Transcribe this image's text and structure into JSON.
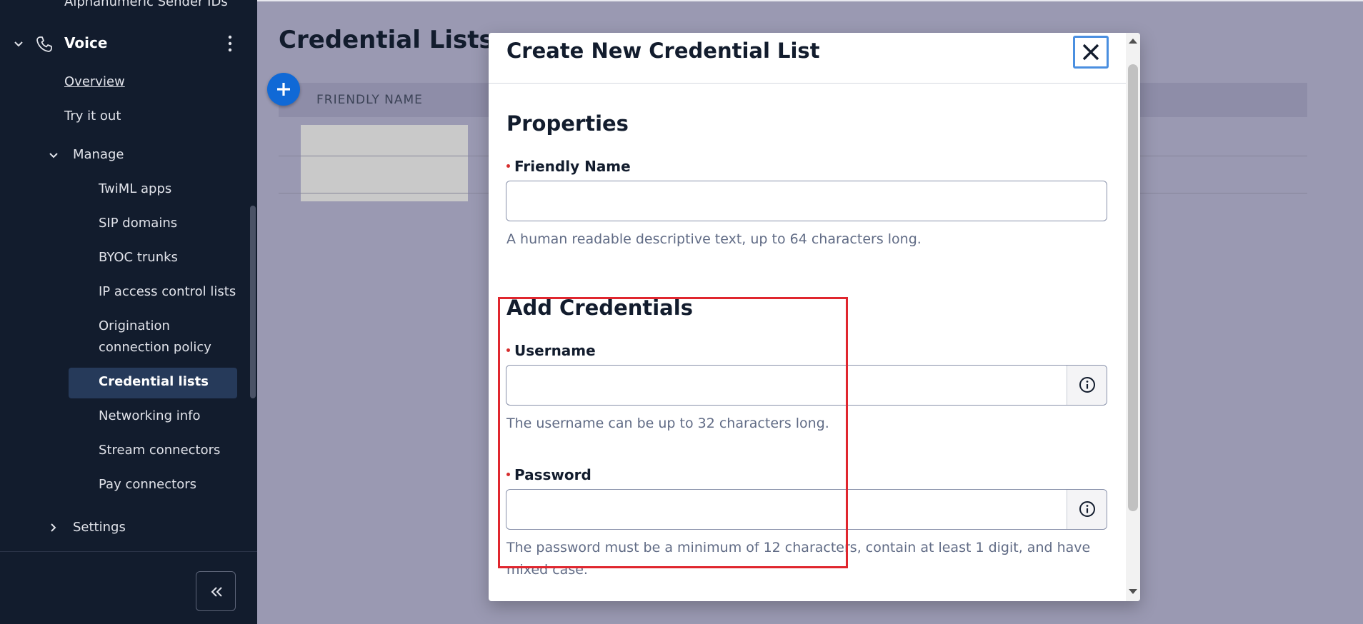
{
  "sidebar": {
    "clipped_item": "Alphanumeric Sender IDs",
    "voice_label": "Voice",
    "overview": "Overview",
    "try_it_out": "Try it out",
    "manage": "Manage",
    "manage_items": [
      "TwiML apps",
      "SIP domains",
      "BYOC trunks",
      "IP access control lists",
      "Origination",
      "connection policy",
      "Credential lists",
      "Networking info",
      "Stream connectors",
      "Pay connectors"
    ],
    "settings": "Settings"
  },
  "main": {
    "page_title": "Credential Lists",
    "table_header_friendly_name": "FRIENDLY NAME"
  },
  "modal": {
    "title": "Create New Credential List",
    "properties_heading": "Properties",
    "friendly_name_label": "Friendly Name",
    "friendly_name_value": "",
    "friendly_name_help": "A human readable descriptive text, up to 64 characters long.",
    "add_credentials_heading": "Add Credentials",
    "username_label": "Username",
    "username_value": "",
    "username_help": "The username can be up to 32 characters long.",
    "password_label": "Password",
    "password_value": "",
    "password_help": "The password must be a minimum of 12 characters, contain at least 1 digit, and have mixed case."
  },
  "colors": {
    "sidebar_bg": "#121c2d",
    "overlay_bg": "#9a99b2",
    "accent_blue": "#1069d6",
    "highlight_red": "#e0262e",
    "required_dot": "#d62d2d"
  },
  "icons": [
    "chevron-down-icon",
    "phone-icon",
    "more-vertical-icon",
    "chevron-right-icon",
    "collapse-left-icon",
    "plus-icon",
    "close-icon",
    "info-icon"
  ]
}
